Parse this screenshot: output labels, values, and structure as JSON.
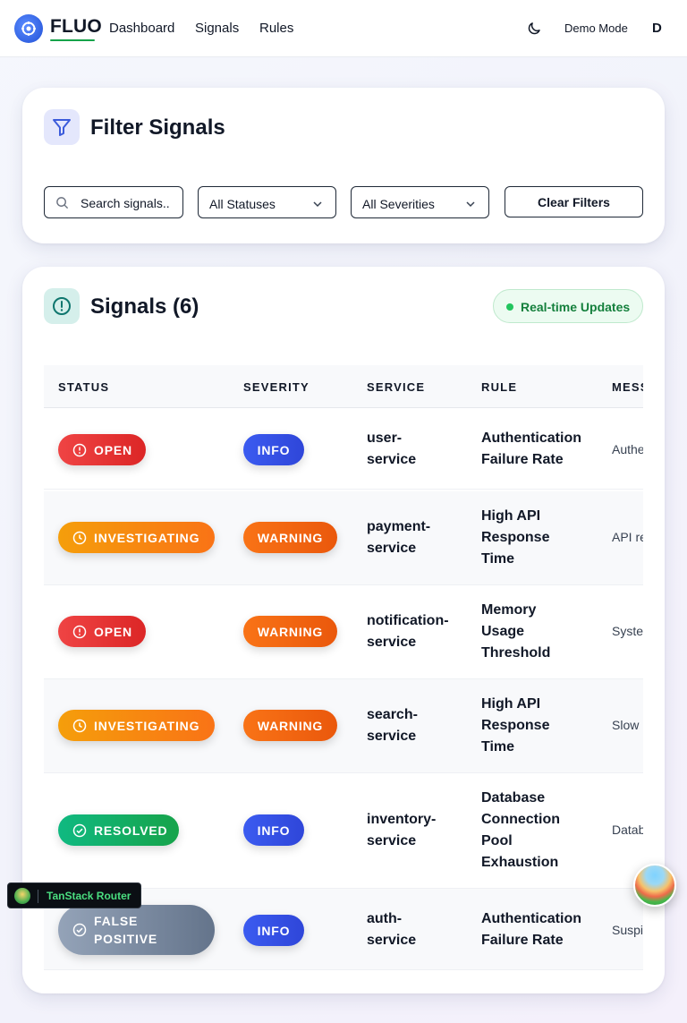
{
  "nav": {
    "brand": "FLUO",
    "links": [
      "Dashboard",
      "Signals",
      "Rules"
    ],
    "demo_mode": "Demo Mode",
    "avatar_letter": "D"
  },
  "filter": {
    "title": "Filter Signals",
    "search_value": "Search signals..",
    "status_selected": "All Statuses",
    "severity_selected": "All Severities",
    "clear_label": "Clear Filters"
  },
  "signals": {
    "title": "Signals (6)",
    "realtime_label": "Real-time Updates",
    "columns": [
      "STATUS",
      "SEVERITY",
      "SERVICE",
      "RULE",
      "MESS"
    ],
    "rows": [
      {
        "status": "OPEN",
        "severity": "INFO",
        "service": [
          "user-",
          "service"
        ],
        "rule": [
          "Authentication",
          "Failure Rate"
        ],
        "message": "Authe"
      },
      {
        "status": "INVESTIGATING",
        "severity": "WARNING",
        "service": [
          "payment-",
          "service"
        ],
        "rule": [
          "High API",
          "Response",
          "Time"
        ],
        "message": "API re"
      },
      {
        "status": "OPEN",
        "severity": "WARNING",
        "service": [
          "notification-",
          "service"
        ],
        "rule": [
          "Memory",
          "Usage",
          "Threshold"
        ],
        "message": "Syste"
      },
      {
        "status": "INVESTIGATING",
        "severity": "WARNING",
        "service": [
          "search-",
          "service"
        ],
        "rule": [
          "High API",
          "Response",
          "Time"
        ],
        "message": "Slow"
      },
      {
        "status": "RESOLVED",
        "severity": "INFO",
        "service": [
          "inventory-",
          "service"
        ],
        "rule": [
          "Database",
          "Connection",
          "Pool",
          "Exhaustion"
        ],
        "message": "Datab"
      },
      {
        "status": [
          "FALSE",
          "POSITIVE"
        ],
        "severity": "INFO",
        "service": [
          "auth-",
          "service"
        ],
        "rule": [
          "Authentication",
          "Failure Rate"
        ],
        "message": "Suspi"
      }
    ]
  },
  "devtools": {
    "tanstack_label": "TanStack Router"
  },
  "colors": {
    "open": "#dc2626",
    "investigating": "#f97316",
    "resolved": "#10b981",
    "false_positive": "#64748b",
    "info": "#3b5bf0",
    "warning": "#ea580c",
    "realtime": "#15803d"
  }
}
